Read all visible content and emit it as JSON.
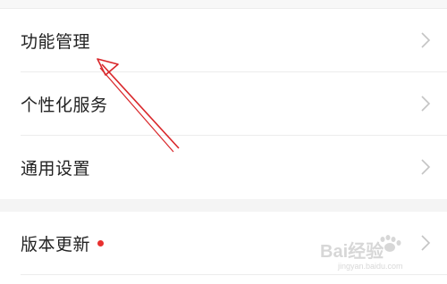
{
  "menu": {
    "items": [
      {
        "label": "功能管理",
        "icon": "chevron-right-icon"
      },
      {
        "label": "个性化服务",
        "icon": "chevron-right-icon"
      },
      {
        "label": "通用设置",
        "icon": "chevron-right-icon"
      }
    ],
    "update": {
      "label": "版本更新",
      "badge_color": "#e8302f",
      "icon": "chevron-right-icon"
    }
  },
  "annotation": {
    "arrow_color": "#d9262a",
    "target": "功能管理"
  },
  "watermark": {
    "text": "Bai经验",
    "subtext": "jingyan.baidu.com"
  }
}
